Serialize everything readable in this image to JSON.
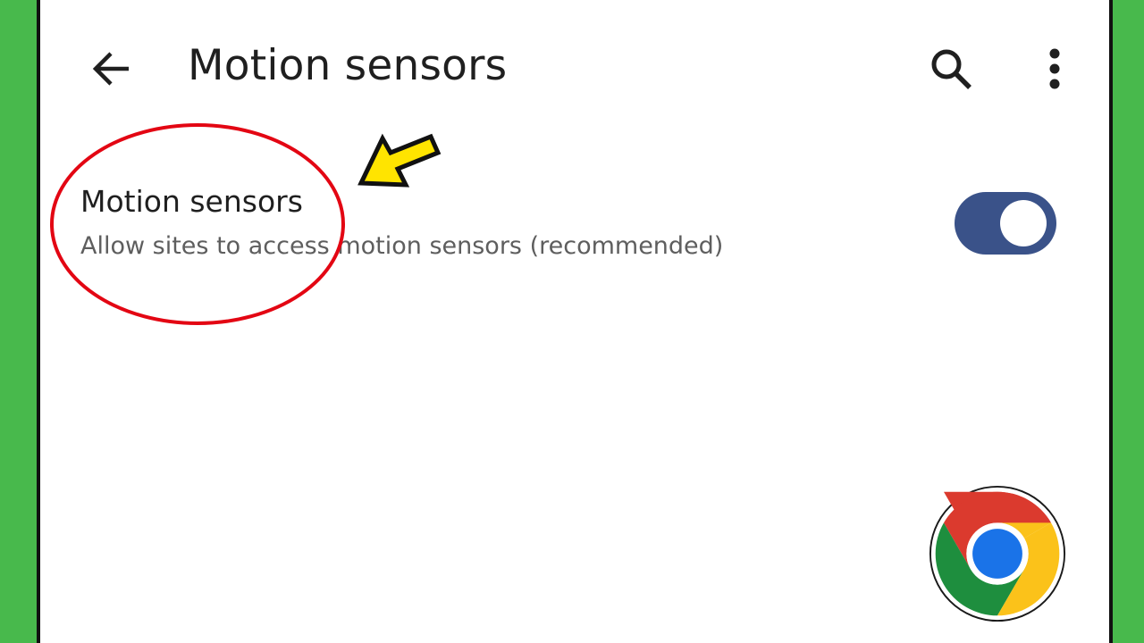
{
  "app_bar": {
    "title": "Motion sensors",
    "back_icon": "arrow-back-icon",
    "search_icon": "search-icon",
    "more_icon": "more-vert-icon"
  },
  "setting": {
    "title": "Motion sensors",
    "summary": "Allow sites to access motion sensors (recommended)",
    "toggle_on": true
  },
  "annotations": {
    "circle_color": "#e30613",
    "arrow_color": "#ffe400"
  },
  "colors": {
    "frame_green": "#48b94c",
    "toggle_track": "#3a5289",
    "toggle_knob": "#ffffff"
  }
}
